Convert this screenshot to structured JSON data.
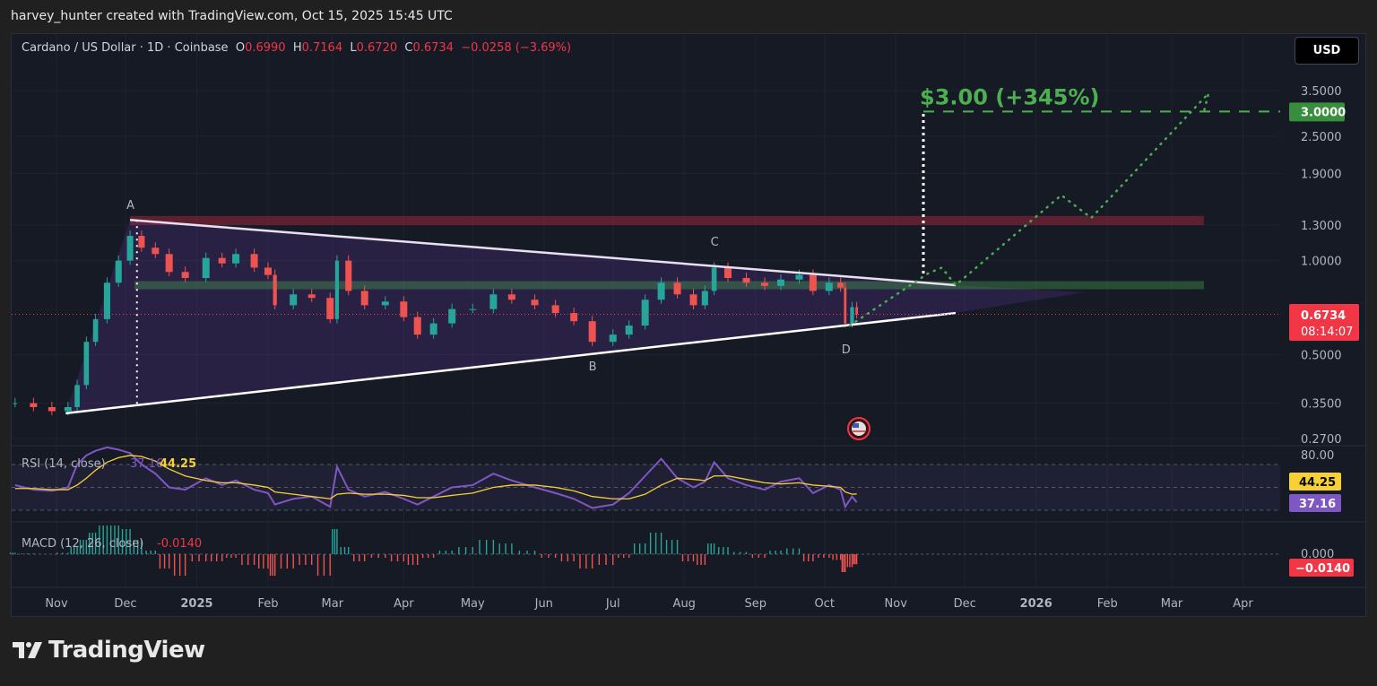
{
  "credit": "harvey_hunter created with TradingView.com, Oct 15, 2025 15:45 UTC",
  "legend": {
    "symbol": "Cardano / US Dollar · 1D · Coinbase",
    "o_label": "O",
    "o": "0.6990",
    "h_label": "H",
    "h": "0.7164",
    "l_label": "L",
    "l": "0.6720",
    "c_label": "C",
    "c": "0.6734",
    "change": "−0.0258 (−3.69%)"
  },
  "currency_button": "USD",
  "footer_logo": "TradingView",
  "colors": {
    "up": "#26a69a",
    "down": "#ef5350",
    "rsi": "#7e57c2",
    "rsi_ma": "#f7d038",
    "target": "#4caf50",
    "price_label": "#f23645"
  },
  "chart_data": {
    "type": "candlestick",
    "scale": "log",
    "ylim": [
      0.27,
      3.6
    ],
    "y_ticks": [
      "3.5000",
      "2.5000",
      "1.9000",
      "1.3000",
      "1.0000",
      "0.5000",
      "0.3500",
      "0.2700"
    ],
    "x_ticks": [
      {
        "label": "Nov",
        "date": "2024-11-01"
      },
      {
        "label": "Dec",
        "date": "2024-12-01"
      },
      {
        "label": "2025",
        "date": "2025-01-01"
      },
      {
        "label": "Feb",
        "date": "2025-02-01"
      },
      {
        "label": "Mar",
        "date": "2025-03-01"
      },
      {
        "label": "Apr",
        "date": "2025-04-01"
      },
      {
        "label": "May",
        "date": "2025-05-01"
      },
      {
        "label": "Jun",
        "date": "2025-06-01"
      },
      {
        "label": "Jul",
        "date": "2025-07-01"
      },
      {
        "label": "Aug",
        "date": "2025-08-01"
      },
      {
        "label": "Sep",
        "date": "2025-09-01"
      },
      {
        "label": "Oct",
        "date": "2025-10-01"
      },
      {
        "label": "Nov",
        "date": "2025-11-01"
      },
      {
        "label": "Dec",
        "date": "2025-12-01"
      },
      {
        "label": "2026",
        "date": "2026-01-01"
      },
      {
        "label": "Feb",
        "date": "2026-02-01"
      },
      {
        "label": "Mar",
        "date": "2026-03-01"
      },
      {
        "label": "Apr",
        "date": "2026-04-01"
      }
    ],
    "prices": [
      [
        "2024-10-14",
        0.35
      ],
      [
        "2024-10-22",
        0.34
      ],
      [
        "2024-10-30",
        0.33
      ],
      [
        "2024-11-06",
        0.34
      ],
      [
        "2024-11-10",
        0.4
      ],
      [
        "2024-11-14",
        0.55
      ],
      [
        "2024-11-18",
        0.65
      ],
      [
        "2024-11-23",
        0.85
      ],
      [
        "2024-11-28",
        1.0
      ],
      [
        "2024-12-03",
        1.2
      ],
      [
        "2024-12-08",
        1.1
      ],
      [
        "2024-12-14",
        1.05
      ],
      [
        "2024-12-20",
        0.92
      ],
      [
        "2024-12-27",
        0.88
      ],
      [
        "2025-01-05",
        1.02
      ],
      [
        "2025-01-12",
        0.98
      ],
      [
        "2025-01-18",
        1.05
      ],
      [
        "2025-01-26",
        0.95
      ],
      [
        "2025-02-01",
        0.9
      ],
      [
        "2025-02-04",
        0.72
      ],
      [
        "2025-02-12",
        0.78
      ],
      [
        "2025-02-20",
        0.76
      ],
      [
        "2025-02-28",
        0.65
      ],
      [
        "2025-03-03",
        1.0
      ],
      [
        "2025-03-08",
        0.8
      ],
      [
        "2025-03-15",
        0.72
      ],
      [
        "2025-03-24",
        0.74
      ],
      [
        "2025-04-01",
        0.66
      ],
      [
        "2025-04-07",
        0.58
      ],
      [
        "2025-04-14",
        0.63
      ],
      [
        "2025-04-22",
        0.7
      ],
      [
        "2025-05-01",
        0.7
      ],
      [
        "2025-05-10",
        0.78
      ],
      [
        "2025-05-18",
        0.75
      ],
      [
        "2025-05-28",
        0.72
      ],
      [
        "2025-06-06",
        0.68
      ],
      [
        "2025-06-14",
        0.64
      ],
      [
        "2025-06-22",
        0.55
      ],
      [
        "2025-07-01",
        0.58
      ],
      [
        "2025-07-08",
        0.62
      ],
      [
        "2025-07-15",
        0.75
      ],
      [
        "2025-07-22",
        0.85
      ],
      [
        "2025-07-29",
        0.78
      ],
      [
        "2025-08-05",
        0.72
      ],
      [
        "2025-08-10",
        0.8
      ],
      [
        "2025-08-14",
        0.95
      ],
      [
        "2025-08-20",
        0.88
      ],
      [
        "2025-08-28",
        0.85
      ],
      [
        "2025-09-05",
        0.83
      ],
      [
        "2025-09-12",
        0.87
      ],
      [
        "2025-09-20",
        0.9
      ],
      [
        "2025-09-26",
        0.8
      ],
      [
        "2025-10-03",
        0.85
      ],
      [
        "2025-10-08",
        0.82
      ],
      [
        "2025-10-10",
        0.63
      ],
      [
        "2025-10-13",
        0.71
      ],
      [
        "2025-10-15",
        0.6734
      ]
    ],
    "rsi_label": "RSI (14, close)",
    "rsi_value": "37.16",
    "rsi_ma_value": "44.25",
    "rsi_top": "80.00",
    "rsi": [
      52,
      48,
      47,
      50,
      70,
      78,
      82,
      85,
      83,
      80,
      70,
      62,
      50,
      48,
      58,
      52,
      56,
      48,
      45,
      35,
      40,
      42,
      33,
      68,
      48,
      42,
      46,
      40,
      35,
      42,
      50,
      52,
      62,
      56,
      50,
      45,
      40,
      32,
      35,
      45,
      60,
      75,
      58,
      50,
      55,
      72,
      58,
      52,
      48,
      55,
      58,
      45,
      52,
      48,
      33,
      42,
      37
    ],
    "rsi_ma": [
      49,
      49,
      48,
      48,
      52,
      58,
      65,
      72,
      76,
      78,
      77,
      73,
      66,
      60,
      56,
      54,
      54,
      52,
      50,
      46,
      44,
      42,
      40,
      44,
      45,
      44,
      44,
      43,
      41,
      41,
      43,
      45,
      50,
      52,
      52,
      50,
      47,
      42,
      40,
      40,
      44,
      52,
      58,
      57,
      56,
      60,
      60,
      57,
      54,
      53,
      54,
      52,
      51,
      50,
      46,
      44,
      44.25
    ],
    "macd_label": "MACD (12, 26, close)",
    "macd_value": "-0.0140",
    "macd_zero": "0.000",
    "macd_hist": [
      0.002,
      0.001,
      0.0,
      0.002,
      0.01,
      0.02,
      0.03,
      0.04,
      0.04,
      0.035,
      0.02,
      0.005,
      -0.02,
      -0.03,
      -0.01,
      -0.01,
      -0.005,
      -0.015,
      -0.02,
      -0.03,
      -0.02,
      -0.015,
      -0.03,
      0.035,
      0.01,
      -0.01,
      -0.005,
      -0.01,
      -0.015,
      -0.005,
      0.005,
      0.01,
      0.02,
      0.015,
      0.005,
      -0.005,
      -0.01,
      -0.02,
      -0.015,
      -0.005,
      0.015,
      0.03,
      0.02,
      -0.01,
      -0.015,
      0.015,
      0.01,
      0.003,
      -0.005,
      0.005,
      0.008,
      -0.01,
      -0.005,
      -0.008,
      -0.025,
      -0.018,
      -0.014
    ],
    "last_price_label": "0.6734",
    "countdown": "08:14:07",
    "target_label": "3.0000",
    "annotations": {
      "points": [
        {
          "label": "A",
          "date": "2024-12-03",
          "price": 1.35
        },
        {
          "label": "B",
          "date": "2025-06-22",
          "price": 0.53
        },
        {
          "label": "C",
          "date": "2025-08-14",
          "price": 1.03
        },
        {
          "label": "D",
          "date": "2025-10-10",
          "price": 0.6
        }
      ],
      "triangle_upper": [
        [
          "2024-12-03",
          1.35
        ],
        [
          "2025-11-27",
          0.835
        ]
      ],
      "triangle_lower": [
        [
          "2024-11-05",
          0.325
        ],
        [
          "2025-11-27",
          0.68
        ]
      ],
      "resistance_zone": {
        "from": "2024-12-03",
        "to": "2026-03-15",
        "low": 1.3,
        "high": 1.39
      },
      "support_zone": {
        "from": "2024-12-05",
        "to": "2026-03-15",
        "low": 0.81,
        "high": 0.86
      },
      "height_line": {
        "date": "2024-12-06",
        "from": 1.35,
        "to": 0.345
      },
      "target_line": {
        "date": "2025-11-13",
        "from": 0.91,
        "to": 3.0
      },
      "target_price": 3.0,
      "target_text": "$3.00 (+345%)",
      "projection": [
        [
          "2025-10-12",
          0.62
        ],
        [
          "2025-11-15",
          0.91
        ],
        [
          "2025-11-21",
          0.95
        ],
        [
          "2025-11-27",
          0.835
        ],
        [
          "2026-01-12",
          1.62
        ],
        [
          "2026-01-25",
          1.37
        ],
        [
          "2026-03-17",
          3.43
        ],
        [
          "2026-03-15",
          3.0
        ]
      ]
    }
  }
}
